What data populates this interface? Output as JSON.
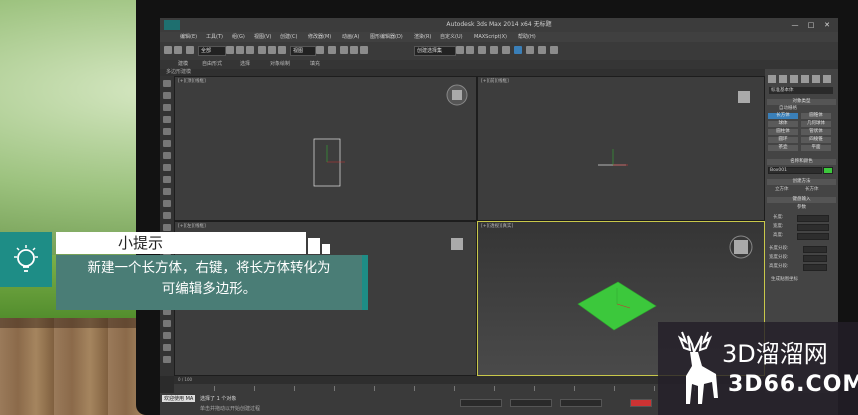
{
  "app": {
    "title": "Autodesk 3ds Max  2014 x64    无标题",
    "minimize": "—",
    "maximize": "□",
    "close": "✕"
  },
  "menu": [
    "编辑(E)",
    "工具(T)",
    "组(G)",
    "视图(V)",
    "创建(C)",
    "修改器(M)",
    "动画(A)",
    "图形编辑器(D)",
    "渲染(R)",
    "自定义(U)",
    "MAXScript(X)",
    "帮助(H)"
  ],
  "toolbar": {
    "selection_filter": "全部",
    "coord_system": "视图",
    "named_selection": "创建选择集"
  },
  "ribbon": {
    "tabs": [
      "建模",
      "自由形式",
      "选择",
      "对象绘制",
      "填充"
    ],
    "subtitle": "多边形建模"
  },
  "viewports": {
    "top_left": "[+][顶][线框]",
    "top_right": "[+][前][线框]",
    "bottom_left": "[+][左][线框]",
    "bottom_right": "[+][透视][真实]"
  },
  "command_panel": {
    "category": "标准基本体",
    "object_type_head": "对象类型",
    "autogrid": "自动栅格",
    "buttons": [
      [
        "长方体",
        "圆锥体"
      ],
      [
        "球体",
        "几何球体"
      ],
      [
        "圆柱体",
        "管状体"
      ],
      [
        "圆环",
        "四棱锥"
      ],
      [
        "茶壶",
        "平面"
      ]
    ],
    "name_color_head": "名称和颜色",
    "object_name": "Box001",
    "creation_method_head": "创建方法",
    "creation_options": [
      "立方体",
      "长方体"
    ],
    "keyboard_entry_head": "键盘输入",
    "parameters_head": "参数",
    "params": [
      "长度:",
      "宽度:",
      "高度:"
    ],
    "segments": [
      "长度分段:",
      "宽度分段:",
      "高度分段:"
    ],
    "gen_mapping": "生成贴图坐标"
  },
  "timeline": {
    "frame": "0 / 100"
  },
  "status": {
    "welcome": "欢迎使用 MA",
    "selected": "选择了 1 个对象",
    "hint": "单击并拖动以开始创建过程"
  },
  "tip": {
    "title": "小提示",
    "body_line1": "新建一个长方体，右键，将长方体转化为",
    "body_line2": "可编辑多边形。"
  },
  "watermark": {
    "name": "3D溜溜网",
    "site": "3D66.COM"
  },
  "colors": {
    "accent_teal": "#1e8d86",
    "tip_body": "#4a7d76",
    "plane_green": "#3cc83c",
    "active_viewport_border": "#c9c84a"
  }
}
